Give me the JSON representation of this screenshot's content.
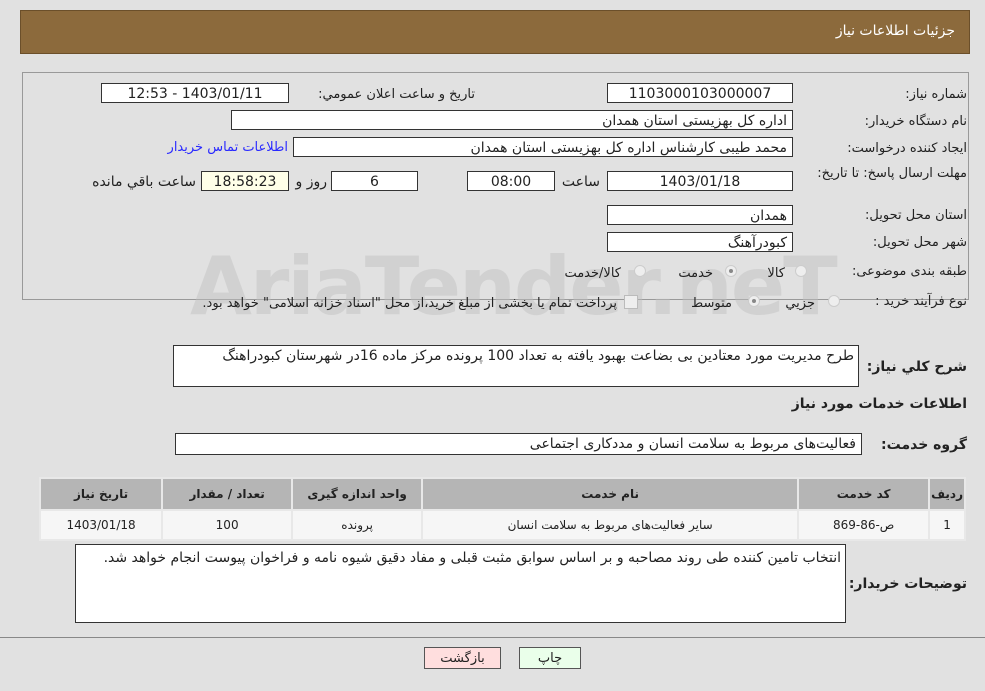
{
  "header": {
    "title": "جزئیات اطلاعات نیاز"
  },
  "watermark": "AriaTender.neT",
  "form": {
    "need_number_label": "شماره نیاز:",
    "need_number": "1103000103000007",
    "announce_label": "تاریخ و ساعت اعلان عمومي:",
    "announce_value": "1403/01/11 - 12:53",
    "buyer_org_label": "نام دستگاه خریدار:",
    "buyer_org": "اداره کل بهزیستی استان همدان",
    "creator_label": "ایجاد کننده درخواست:",
    "creator": "محمد طیبی کارشناس اداره کل بهزیستی استان همدان",
    "contact_link": "اطلاعات تماس خریدار",
    "deadline_label": "مهلت ارسال پاسخ: تا تاریخ:",
    "deadline_date": "1403/01/18",
    "time_label": "ساعت",
    "deadline_time": "08:00",
    "days": "6",
    "days_label": "روز و",
    "remaining": "18:58:23",
    "remaining_label": "ساعت باقي مانده",
    "province_label": "استان محل تحویل:",
    "province": "همدان",
    "city_label": "شهر محل تحویل:",
    "city": "کبودرآهنگ",
    "category_label": "طبقه بندی موضوعی:",
    "category_options": [
      "کالا",
      "خدمت",
      "کالا/خدمت"
    ],
    "category_selected": "خدمت",
    "process_label": "نوع فرآیند خرید :",
    "process_options": [
      "جزيي",
      "متوسط"
    ],
    "process_selected": "متوسط",
    "payment_note": "پرداخت تمام یا بخشی از مبلغ خرید،از محل \"اسناد خزانه اسلامی\" خواهد بود.",
    "payment_checked": false
  },
  "summary_label": "شرح کلي نیاز:",
  "summary": "طرح مدیریت مورد معتادین بی بضاعت بهبود یافته به تعداد 100 پرونده مرکز ماده 16در شهرستان کبودراهنگ",
  "services_title": "اطلاعات خدمات مورد نیاز",
  "service_group_label": "گروه خدمت:",
  "service_group": "فعالیت‌های مربوط به سلامت انسان و مددکاری اجتماعی",
  "table": {
    "headers": [
      "ردیف",
      "کد خدمت",
      "نام خدمت",
      "واحد اندازه گیری",
      "تعداد / مقدار",
      "تاریخ نیاز"
    ],
    "rows": [
      [
        "1",
        "ص-86-869",
        "سایر فعالیت‌های مربوط به سلامت انسان",
        "پرونده",
        "100",
        "1403/01/18"
      ]
    ]
  },
  "notes_label": "توضیحات خریدار:",
  "notes": "انتخاب تامین کننده طی روند مصاحبه و بر اساس سوابق مثبت قبلی و مفاد دقیق شیوه نامه و فراخوان پیوست انجام خواهد شد.",
  "buttons": {
    "print": "چاپ",
    "back": "بازگشت"
  }
}
